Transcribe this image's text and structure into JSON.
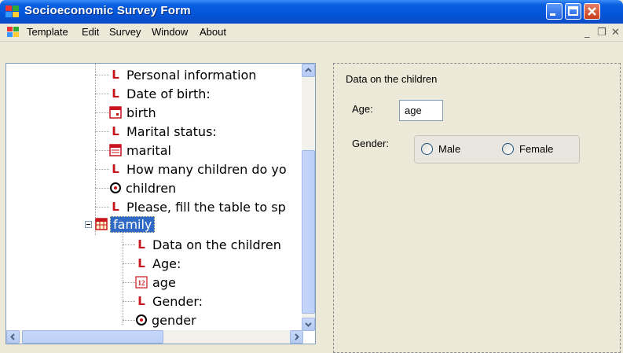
{
  "window": {
    "title": "Socioeconomic Survey Form"
  },
  "menu": {
    "items": [
      "Template",
      "Edit",
      "Survey",
      "Window",
      "About"
    ]
  },
  "tree": {
    "items": [
      {
        "label": "Personal information",
        "icon": "label-icon"
      },
      {
        "label": "Date of birth:",
        "icon": "label-icon"
      },
      {
        "label": "birth",
        "icon": "date-field-icon"
      },
      {
        "label": "Marital status:",
        "icon": "label-icon"
      },
      {
        "label": "marital",
        "icon": "dropdown-field-icon"
      },
      {
        "label": "How many children do yo",
        "icon": "label-icon"
      },
      {
        "label": "children",
        "icon": "radio-field-icon"
      },
      {
        "label": "Please, fill the table to sp",
        "icon": "label-icon"
      },
      {
        "label": "family",
        "icon": "table-icon",
        "selected": true
      },
      {
        "label": "Data on the children",
        "icon": "label-icon"
      },
      {
        "label": "Age:",
        "icon": "label-icon"
      },
      {
        "label": "age",
        "icon": "numeric-field-icon"
      },
      {
        "label": "Gender:",
        "icon": "label-icon"
      },
      {
        "label": "gender",
        "icon": "radio-field-icon"
      }
    ]
  },
  "form": {
    "title": "Data on the children",
    "age_label": "Age:",
    "age_value": "age",
    "gender_label": "Gender:",
    "gender_options": [
      "Male",
      "Female"
    ]
  }
}
